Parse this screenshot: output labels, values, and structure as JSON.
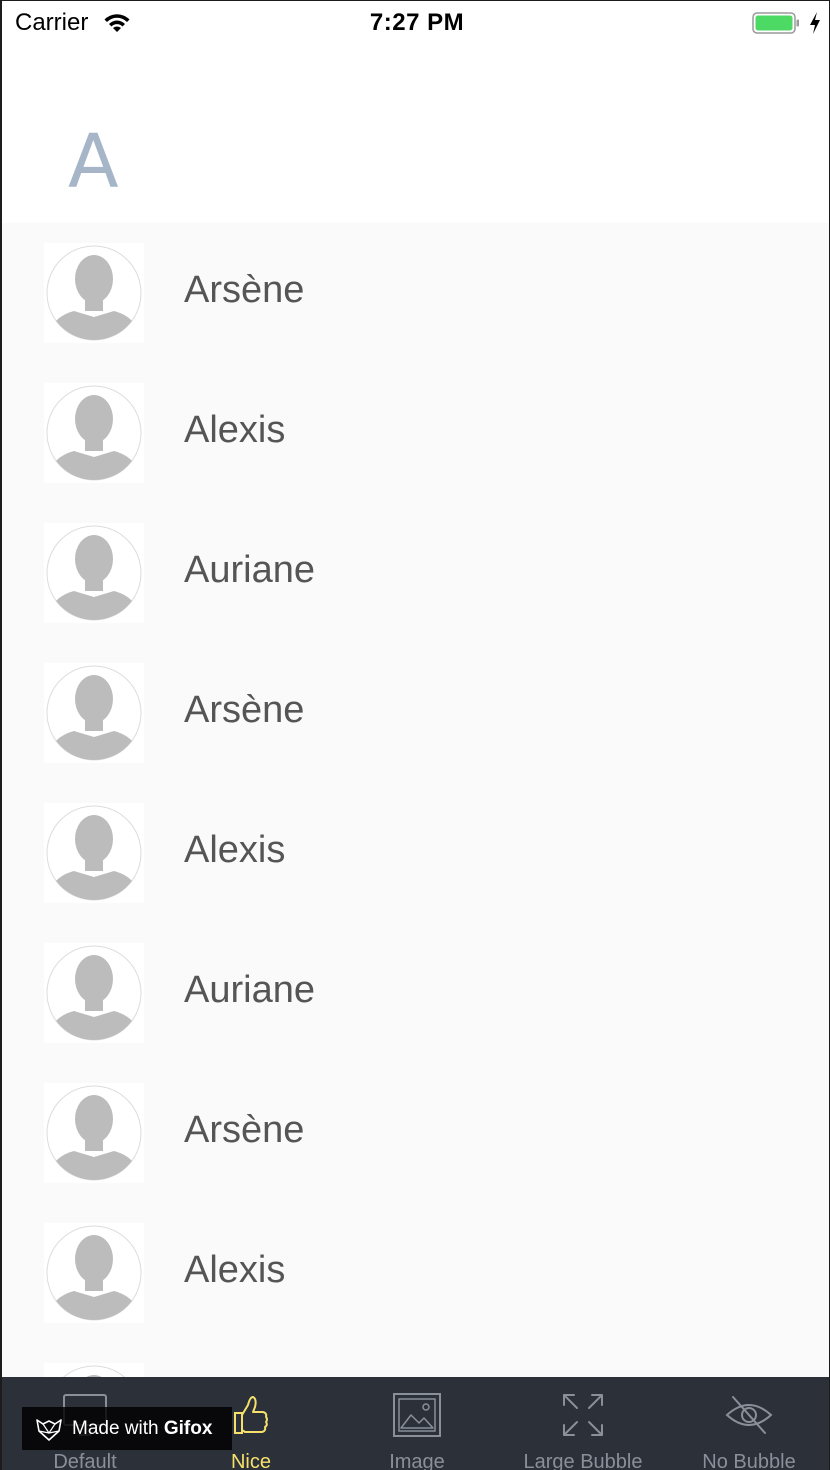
{
  "status_bar": {
    "carrier": "Carrier",
    "time": "7:27 PM",
    "battery_color": "#4cd964"
  },
  "section": {
    "letter": "A",
    "letter_color": "#a6b6c8"
  },
  "contacts": [
    {
      "name": "Arsène",
      "avatar": "person-placeholder-icon"
    },
    {
      "name": "Alexis",
      "avatar": "person-placeholder-icon"
    },
    {
      "name": "Auriane",
      "avatar": "person-placeholder-icon"
    },
    {
      "name": "Arsène",
      "avatar": "person-placeholder-icon"
    },
    {
      "name": "Alexis",
      "avatar": "person-placeholder-icon"
    },
    {
      "name": "Auriane",
      "avatar": "person-placeholder-icon"
    },
    {
      "name": "Arsène",
      "avatar": "person-placeholder-icon"
    },
    {
      "name": "Alexis",
      "avatar": "person-placeholder-icon"
    },
    {
      "name": "",
      "avatar": "person-placeholder-icon"
    }
  ],
  "tab_bar": {
    "background": "#2c3038",
    "active_color": "#f5e06b",
    "tabs": [
      {
        "label": "Default",
        "icon": "monitor-icon",
        "active": false
      },
      {
        "label": "Nice",
        "icon": "thumbs-up-icon",
        "active": true
      },
      {
        "label": "Image",
        "icon": "image-icon",
        "active": false
      },
      {
        "label": "Large Bubble",
        "icon": "expand-icon",
        "active": false
      },
      {
        "label": "No Bubble",
        "icon": "eye-slash-icon",
        "active": false
      }
    ]
  },
  "watermark": {
    "prefix": "Made with ",
    "brand": "Gifox",
    "icon": "gifox-logo-icon"
  }
}
